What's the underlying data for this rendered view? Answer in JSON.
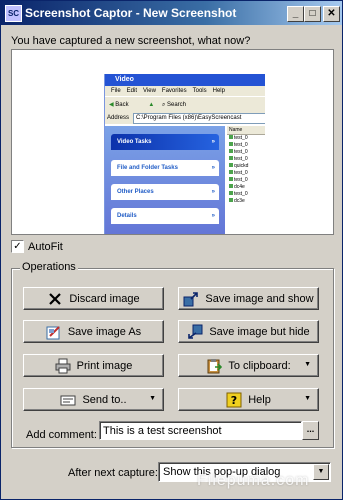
{
  "window": {
    "title": "Screenshot Captor - New Screenshot",
    "icon_label": "SC",
    "controls": {
      "minimize": "_",
      "maximize": "□",
      "close": "✕"
    }
  },
  "prompt": "You have captured a new screenshot, what now?",
  "preview": {
    "window_title": "Video",
    "menu": [
      "File",
      "Edit",
      "View",
      "Favorites",
      "Tools",
      "Help"
    ],
    "toolbar": {
      "back": "Back",
      "search": "Search"
    },
    "address_label": "Address",
    "address_value": "C:\\Program Files (x86)\\EasyScreencast",
    "tasks": [
      "Video Tasks",
      "File and Folder Tasks",
      "Other Places",
      "Details"
    ],
    "column_header": "Name",
    "files": [
      "test_0",
      "test_0",
      "test_0",
      "test_0",
      "quickd",
      "test_0",
      "test_0",
      "dc4e",
      "test_0",
      "dc3e"
    ]
  },
  "autofit": {
    "label": "AutoFit",
    "checked": true
  },
  "operations": {
    "label": "Operations",
    "buttons": {
      "discard": "Discard image",
      "save_show": "Save image and show",
      "save_as": "Save image As",
      "save_hide": "Save image but hide",
      "print": "Print image",
      "clipboard": "To clipboard:",
      "send_to": "Send to..",
      "help": "Help"
    },
    "comment_label": "Add comment:",
    "comment_value": "This is a test screenshot",
    "ellipsis": "..."
  },
  "after_capture": {
    "label": "After next capture:",
    "selected": "Show this pop-up dialog"
  },
  "watermark": "Filepuma.com",
  "colors": {
    "title_bar": "#0a246a",
    "face": "#d4d0c8",
    "xp_blue": "#2453d4"
  }
}
